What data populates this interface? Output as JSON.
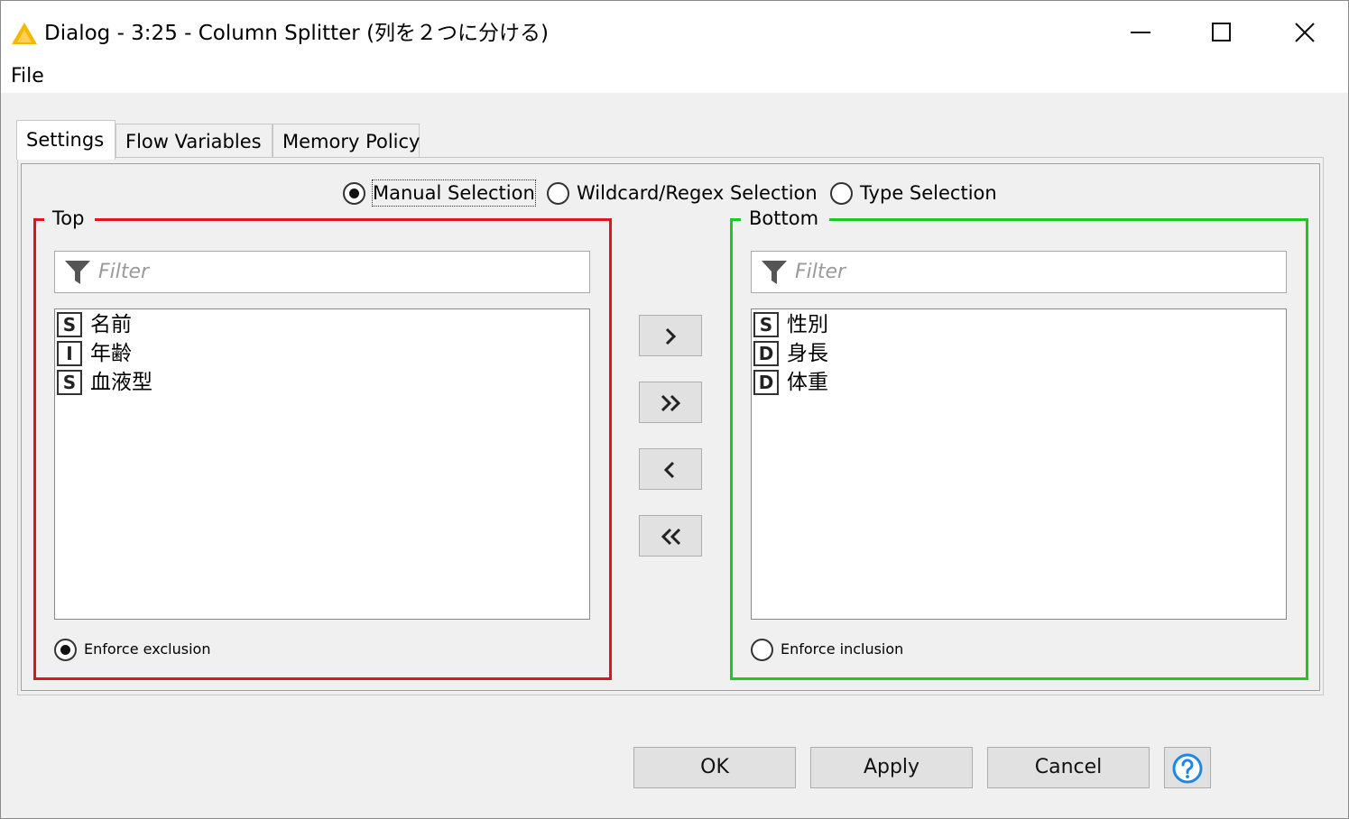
{
  "window": {
    "title": "Dialog - 3:25 - Column Splitter (列を２つに分ける)",
    "app_icon": "knime-warning-triangle-icon",
    "controls": [
      "minimize-icon",
      "maximize-icon",
      "close-icon"
    ]
  },
  "menu": {
    "items": [
      "File"
    ]
  },
  "tabs": [
    {
      "label": "Settings",
      "active": true
    },
    {
      "label": "Flow Variables",
      "active": false
    },
    {
      "label": "Memory Policy",
      "active": false
    }
  ],
  "selection_mode": {
    "options": [
      "Manual Selection",
      "Wildcard/Regex Selection",
      "Type Selection"
    ],
    "selected": "Manual Selection"
  },
  "top": {
    "title": "Top",
    "filter_placeholder": "Filter",
    "items": [
      {
        "type": "S",
        "name": "名前"
      },
      {
        "type": "I",
        "name": "年齢"
      },
      {
        "type": "S",
        "name": "血液型"
      }
    ],
    "enforce_label": "Enforce exclusion",
    "enforce_checked": true
  },
  "bottom": {
    "title": "Bottom",
    "filter_placeholder": "Filter",
    "items": [
      {
        "type": "S",
        "name": "性別"
      },
      {
        "type": "D",
        "name": "身長"
      },
      {
        "type": "D",
        "name": "体重"
      }
    ],
    "enforce_label": "Enforce inclusion",
    "enforce_checked": false
  },
  "move_buttons": [
    "chevron-right-icon",
    "double-chevron-right-icon",
    "chevron-left-icon",
    "double-chevron-left-icon"
  ],
  "buttons": {
    "ok": "OK",
    "apply": "Apply",
    "cancel": "Cancel",
    "help_icon": "help-question-icon"
  },
  "colors": {
    "top_border": "#e0141e",
    "bottom_border": "#1ec81e",
    "help_accent": "#1e88e5",
    "app_icon": "#f5b800"
  }
}
